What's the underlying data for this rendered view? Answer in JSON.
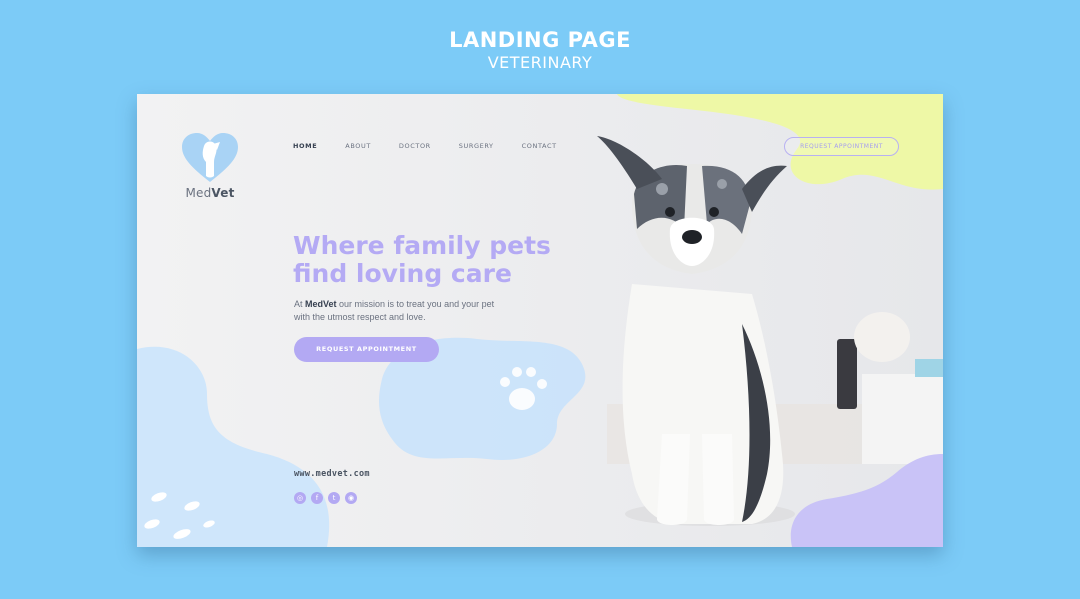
{
  "banner": {
    "title": "LANDING PAGE",
    "subtitle": "VETERINARY"
  },
  "colors": {
    "backdrop": "#7ccbf7",
    "accent_purple": "#b3a9f3",
    "blob_blue": "#cfe6fb",
    "blob_yellow": "#eef8a6",
    "blob_lavender": "#c9c3f7"
  },
  "logo": {
    "name_light": "Med",
    "name_bold": "Vet",
    "icon": "heart-dog-icon"
  },
  "nav": {
    "items": [
      "HOME",
      "ABOUT",
      "DOCTOR",
      "SURGERY",
      "CONTACT"
    ],
    "active": "HOME"
  },
  "header": {
    "request_label": "REQUEST APPOINTMENT"
  },
  "hero": {
    "headline_line1": "Where family pets",
    "headline_line2": "find loving care",
    "desc_prefix": "At ",
    "desc_brand": "MedVet",
    "desc_rest": " our mission is to treat you and your pet with the utmost respect and love.",
    "cta_label": "REQUEST APPOINTMENT"
  },
  "footer": {
    "url": "www.medvet.com",
    "socials": [
      "instagram-icon",
      "facebook-icon",
      "twitter-icon",
      "dribbble-icon"
    ],
    "social_glyphs": [
      "◎",
      "f",
      "t",
      "◉"
    ]
  }
}
